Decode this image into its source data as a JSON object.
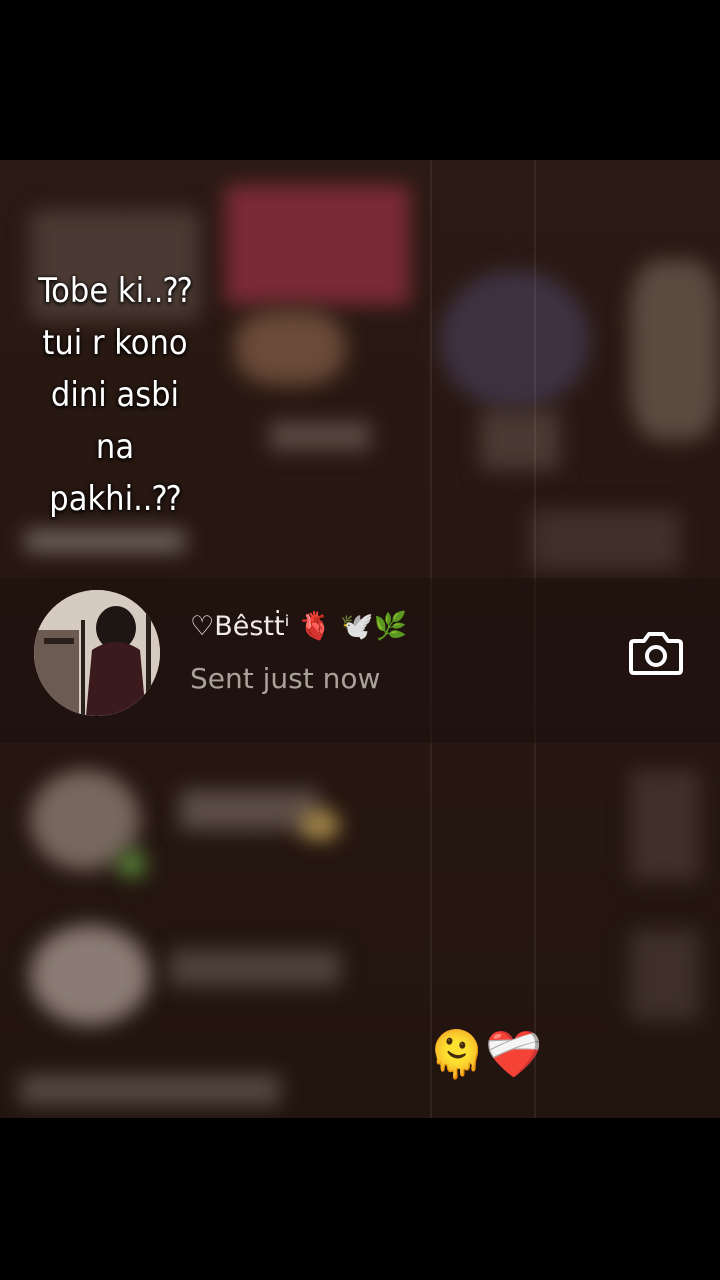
{
  "overlay_text": "Tobe ki..⁇\ntui r kono\ndini asbi\nna\npakhi..⁇",
  "chat_row": {
    "name": "♡Bêstṫⁱ 🫀 🕊️🌿",
    "subtitle": "Sent just now"
  },
  "icons": {
    "camera": "camera-icon"
  },
  "emojis": "🫠❤️‍🩹",
  "colors": {
    "background": "#271711",
    "text": "#ffffff",
    "subtitle": "#a9a09a"
  }
}
